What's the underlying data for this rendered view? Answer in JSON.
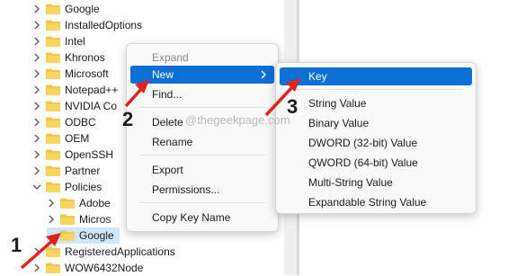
{
  "tree": {
    "items": [
      {
        "label": "Google"
      },
      {
        "label": "InstalledOptions"
      },
      {
        "label": "Intel"
      },
      {
        "label": "Khronos"
      },
      {
        "label": "Microsoft"
      },
      {
        "label": "Notepad++"
      },
      {
        "label": "NVIDIA Co"
      },
      {
        "label": "ODBC"
      },
      {
        "label": "OEM"
      },
      {
        "label": "OpenSSH"
      },
      {
        "label": "Partner"
      },
      {
        "label": "Policies"
      },
      {
        "label": "Adobe"
      },
      {
        "label": "Micros"
      },
      {
        "label": "Google"
      },
      {
        "label": "RegisteredApplications"
      },
      {
        "label": "WOW6432Node"
      }
    ]
  },
  "context_menu": {
    "items": [
      "Expand",
      "New",
      "Find...",
      "Delete",
      "Rename",
      "Export",
      "Permissions...",
      "Copy Key Name"
    ]
  },
  "sub_menu": {
    "items": [
      "Key",
      "String Value",
      "Binary Value",
      "DWORD (32-bit) Value",
      "QWORD (64-bit) Value",
      "Multi-String Value",
      "Expandable String Value"
    ]
  },
  "watermark": "@thegeekpage.com",
  "callouts": [
    "1",
    "2",
    "3"
  ],
  "colors": {
    "highlight": "#0b6fd6",
    "selection": "#cfe6fb",
    "folder": "#f2c84b",
    "arrow": "#e0241b"
  }
}
